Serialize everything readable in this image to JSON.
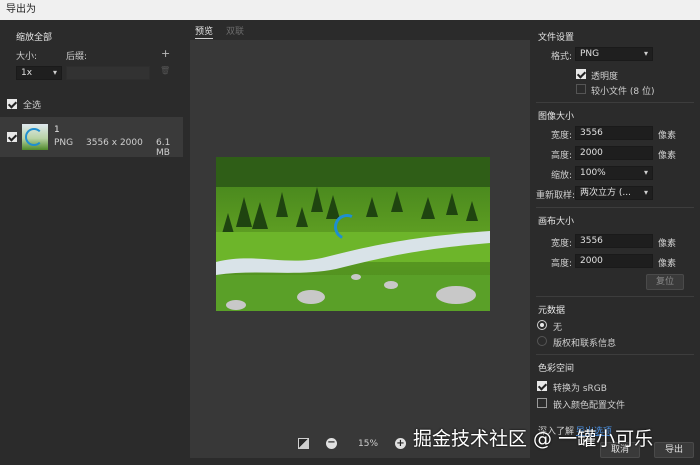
{
  "window": {
    "title": "导出为"
  },
  "left": {
    "scale_all": "缩放全部",
    "size_label": "大小:",
    "suffix_label": "后缀:",
    "add_icon": "+",
    "trash_icon": "🗑",
    "size_value": "1x",
    "select_all": "全选",
    "asset": {
      "name": "1",
      "format": "PNG",
      "dims": "3556 x 2000",
      "filesize": "6.1 MB"
    }
  },
  "center": {
    "tab_preview": "预览",
    "tab_double": "双联",
    "zoom": "15%",
    "zoom_out": "−",
    "zoom_in": "+"
  },
  "right": {
    "file_settings": "文件设置",
    "format_label": "格式:",
    "format_value": "PNG",
    "transparency": "透明度",
    "smaller_file": "较小文件 (8 位)",
    "image_size": "图像大小",
    "width_label": "宽度:",
    "width_value": "3556",
    "height_label": "高度:",
    "height_value": "2000",
    "unit": "像素",
    "scale_label": "缩放:",
    "scale_value": "100%",
    "resample_label": "重新取样:",
    "resample_value": "两次立方 (...",
    "canvas_size": "画布大小",
    "canvas_width_value": "3556",
    "canvas_height_value": "2000",
    "reset": "复位",
    "metadata": "元数据",
    "meta_none": "无",
    "meta_copyright": "版权和联系信息",
    "color_space": "色彩空间",
    "convert_srgb": "转换为 sRGB",
    "embed_profile": "嵌入颜色配置文件",
    "learn_more": "深入了解",
    "export_options": "导出选项",
    "cancel": "取消",
    "export": "导出"
  },
  "watermark": "掘金技术社区 @ 一罐小可乐",
  "colors": {
    "accent": "#1473e6",
    "panel": "#2b2b2b",
    "viewport": "#383838"
  }
}
